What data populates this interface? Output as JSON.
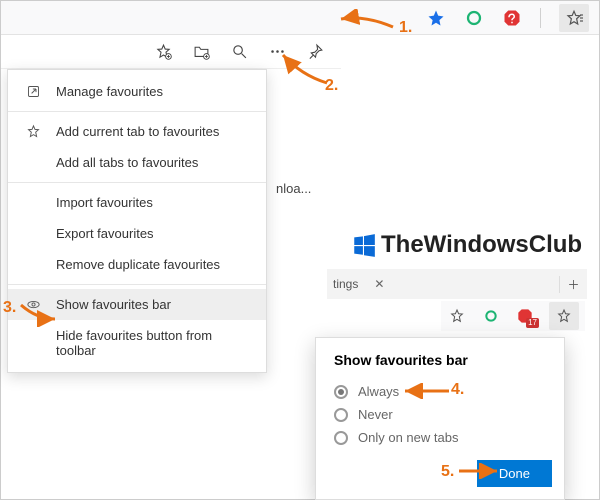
{
  "top_toolbar": {
    "icons": [
      "star-filled-icon",
      "refresh-icon",
      "adblock-icon",
      "favourites-hub-icon"
    ]
  },
  "sub_toolbar": {
    "icons": [
      "add-favourite-icon",
      "add-folder-icon",
      "search-icon",
      "more-icon",
      "pin-icon"
    ]
  },
  "menu": {
    "items": [
      {
        "icon": "open-icon",
        "label": "Manage favourites"
      },
      {
        "divider": true
      },
      {
        "icon": "star-add-icon",
        "label": "Add current tab to favourites"
      },
      {
        "icon": "",
        "label": "Add all tabs to favourites"
      },
      {
        "divider": true
      },
      {
        "icon": "",
        "label": "Import favourites"
      },
      {
        "icon": "",
        "label": "Export favourites"
      },
      {
        "icon": "",
        "label": "Remove duplicate favourites"
      },
      {
        "divider": true
      },
      {
        "icon": "eye-icon",
        "label": "Show favourites bar",
        "highlight": true
      },
      {
        "icon": "",
        "label": "Hide favourites button from toolbar"
      }
    ]
  },
  "watermark": {
    "text": "TheWindowsClub"
  },
  "crop": {
    "text1": "nloa...",
    "tab_label": "tings",
    "badge_count": "17"
  },
  "popup": {
    "title": "Show favourites bar",
    "options": [
      "Always",
      "Never",
      "Only on new tabs"
    ],
    "selected": 0,
    "done_label": "Done"
  },
  "annotations": {
    "n1": "1.",
    "n2": "2.",
    "n3": "3.",
    "n4": "4.",
    "n5": "5."
  }
}
